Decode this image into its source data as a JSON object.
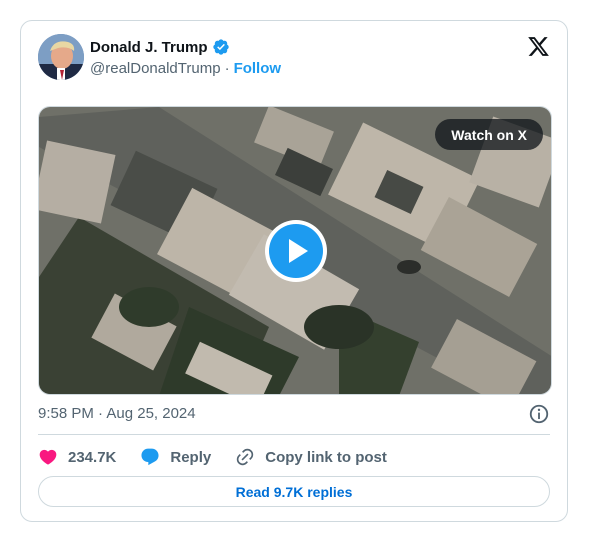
{
  "author": {
    "display_name": "Donald J. Trump",
    "handle": "@realDonaldTrump",
    "separator": "·",
    "follow_label": "Follow",
    "verified_color": "#1d9bf0"
  },
  "media": {
    "watch_label": "Watch on X",
    "play_color": "#1d9bf0"
  },
  "meta": {
    "timestamp": "9:58 PM · Aug 25, 2024"
  },
  "actions": {
    "likes": "234.7K",
    "reply_label": "Reply",
    "copy_link_label": "Copy link to post",
    "like_color": "#f91880",
    "reply_color": "#1d9bf0"
  },
  "replies_button": {
    "label": "Read 9.7K replies"
  },
  "icons": [
    "verified-badge-icon",
    "x-logo-icon",
    "play-icon",
    "info-icon",
    "heart-icon",
    "reply-bubble-icon",
    "link-icon"
  ]
}
